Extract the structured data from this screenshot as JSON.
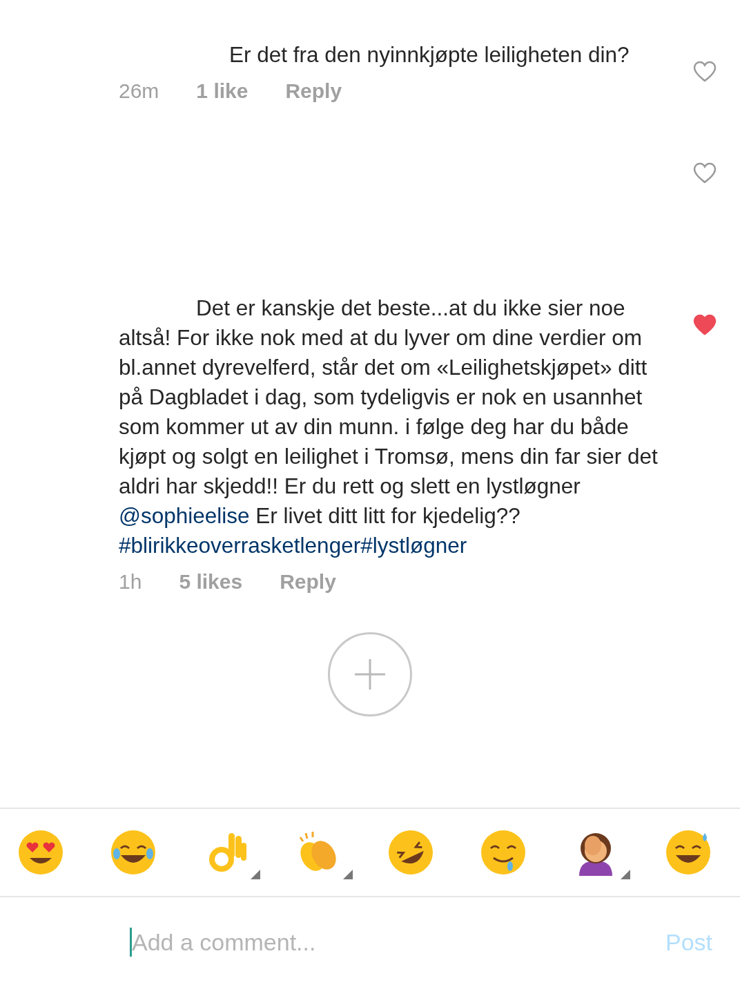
{
  "comments": [
    {
      "parts": [
        {
          "kind": "text",
          "text": "Er det fra den nyinnkjøpte leiligheten din?"
        }
      ],
      "time": "26m",
      "likes": "1 like",
      "reply": "Reply",
      "liked": false
    },
    {
      "liked": false
    },
    {
      "parts": [
        {
          "kind": "text",
          "text": "Det er kanskje det beste...at du ikke sier noe altså! For ikke nok med at du lyver om dine verdier om bl.annet dyrevelferd, står det om «Leilighetskjøpet» ditt på Dagbladet i dag, som tydeligvis er nok en usannhet som kommer ut av din munn. i følge deg har du både kjøpt og solgt en leilighet i Tromsø, mens din far sier det aldri har skjedd!! Er du rett og slett en lystløgner "
        },
        {
          "kind": "mention",
          "text": "@sophieelise"
        },
        {
          "kind": "text",
          "text": " Er livet ditt litt for kjedelig?? "
        },
        {
          "kind": "hashtag",
          "text": "#blirikkeoverrasketlenger#lystløgner"
        }
      ],
      "time": "1h",
      "likes": "5 likes",
      "reply": "Reply",
      "liked": true
    }
  ],
  "emojis": [
    {
      "kind": "heart-eyes",
      "variants": false
    },
    {
      "kind": "tears-of-joy",
      "variants": false
    },
    {
      "kind": "ok-hand",
      "variants": true
    },
    {
      "kind": "clapping",
      "variants": true
    },
    {
      "kind": "rolling-laugh",
      "variants": false
    },
    {
      "kind": "drooling",
      "variants": false
    },
    {
      "kind": "facepalm",
      "variants": true
    },
    {
      "kind": "sweat-smile",
      "variants": false
    }
  ],
  "composer": {
    "placeholder": "Add a comment...",
    "post": "Post",
    "post_enabled": false
  }
}
